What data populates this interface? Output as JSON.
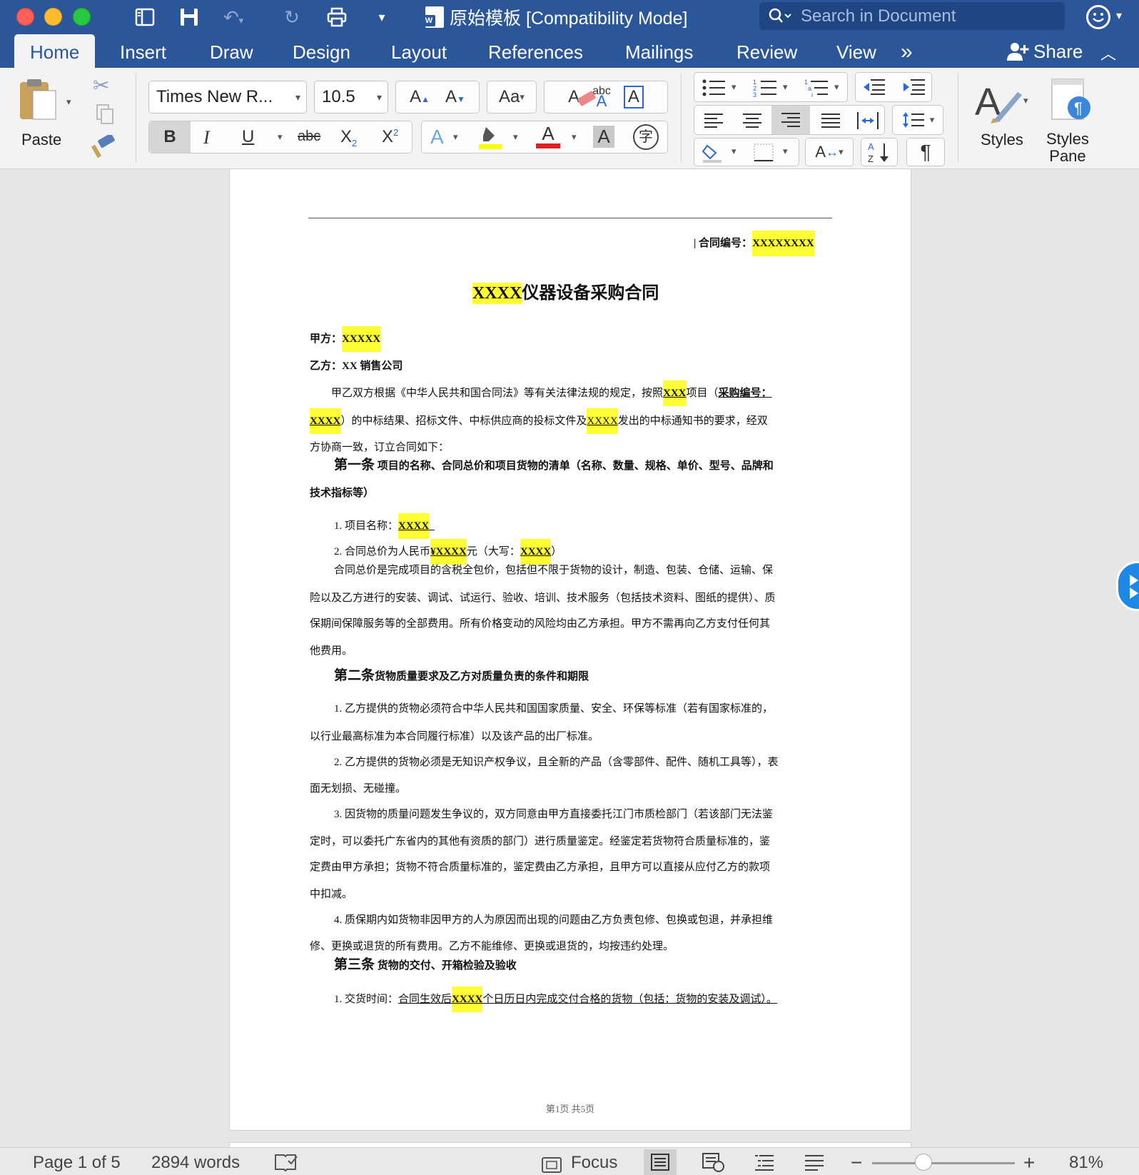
{
  "window": {
    "title": "原始模板 [Compatibility Mode]",
    "search_placeholder": "Search in Document"
  },
  "tabs": [
    "Home",
    "Insert",
    "Draw",
    "Design",
    "Layout",
    "References",
    "Mailings",
    "Review",
    "View"
  ],
  "tabs_overflow": "»",
  "share_label": "Share",
  "ribbon": {
    "paste_label": "Paste",
    "font_name": "Times New R...",
    "font_size": "10.5",
    "styles_label": "Styles",
    "styles_pane_label_1": "Styles",
    "styles_pane_label_2": "Pane",
    "format_buttons": {
      "bold": "B",
      "italic": "I",
      "underline": "U",
      "strike": "abc",
      "abc_check": "abc",
      "grow_font": "A",
      "shrink_font": "A",
      "change_case": "Aa",
      "text_box": "A",
      "text_effects": "A",
      "font_color": "A",
      "char_shading": "A",
      "phonetic": "字",
      "pilcrow": "¶"
    },
    "colors": {
      "highlight": "#ffff00",
      "font_color": "#e02020",
      "accent": "#2b579a"
    }
  },
  "document": {
    "contract_no_label": "| 合同编号：",
    "contract_no_value": "XXXXXXXX",
    "title_hl": "XXXX",
    "title_rest": "仪器设备采购合同",
    "party_a_label": "甲方：",
    "party_a_value": "XXXXX",
    "party_b": "乙方：XX 销售公司",
    "intro_1a": "甲乙双方根据《中华人民共和国合同法》等有关法律法规的规定，按照",
    "intro_1b": "XXX",
    "intro_1c": "项目（",
    "intro_1d": "采购编号：",
    "intro_2a": "XXXX",
    "intro_2b": "）的中标结果、招标文件、中标供应商的投标文件及",
    "intro_2c": "XXXX",
    "intro_2d": "发出的中标通知书的要求，经双",
    "intro_3": "方协商一致，订立合同如下：",
    "art1_no": "第一条",
    "art1_title_1": "项目的名称、合同总价和项目货物的清单（名称、数量、规格、单价、型号、品牌和",
    "art1_title_2": "技术指标等）",
    "a1_item1_label": "1. 项目名称：",
    "a1_item1_value": "XXXX",
    "a1_item2_a": "2. 合同总价为人民币",
    "a1_item2_b": "¥XXXX",
    "a1_item2_c": "元（大写：",
    "a1_item2_d": "XXXX",
    "a1_item2_e": "）",
    "a1_p1": "合同总价是完成项目的含税全包价，包括但不限于货物的设计，制造、包装、仓储、运输、保",
    "a1_p2": "险以及乙方进行的安装、调试、试运行、验收、培训、技术服务（包括技术资料、图纸的提供）、质",
    "a1_p3": "保期间保障服务等的全部费用。所有价格变动的风险均由乙方承担。甲方不需再向乙方支付任何其",
    "a1_p4": "他费用。",
    "art2_no": "第二条",
    "art2_title": "货物质量要求及乙方对质量负责的条件和期限",
    "a2_1a": "1. 乙方提供的货物必须符合中华人民共和国国家质量、安全、环保等标准（若有国家标准的，",
    "a2_1b": "以行业最高标准为本合同履行标准）以及该产品的出厂标准。",
    "a2_2a": "2. 乙方提供的货物必须是无知识产权争议，且全新的产品（含零部件、配件、随机工具等），表",
    "a2_2b": "面无划损、无碰撞。",
    "a2_3a": "3. 因货物的质量问题发生争议的，双方同意由甲方直接委托江门市质检部门（若该部门无法鉴",
    "a2_3b": "定时，可以委托广东省内的其他有资质的部门）进行质量鉴定。经鉴定若货物符合质量标准的，鉴",
    "a2_3c": "定费由甲方承担；货物不符合质量标准的，鉴定费由乙方承担，且甲方可以直接从应付乙方的款项",
    "a2_3d": "中扣减。",
    "a2_4a": "4. 质保期内如货物非因甲方的人为原因而出现的问题由乙方负责包修、包换或包退，并承担维",
    "a2_4b": "修、更换或退货的所有费用。乙方不能维修、更换或退货的，均按违约处理。",
    "art3_no": "第三条",
    "art3_title": "货物的交付、开箱检验及验收",
    "a3_1a": "1. 交货时间：",
    "a3_1b": "合同生效后",
    "a3_1c": "XXXX",
    "a3_1d": "个日历日内完成交付合格的货物（包括：货物的安装及调试）。",
    "page_footer": "第1页  共5页"
  },
  "status": {
    "page": "Page 1 of 5",
    "words": "2894 words",
    "focus": "Focus",
    "zoom": "81%",
    "zoom_level_fraction": 0.36
  }
}
